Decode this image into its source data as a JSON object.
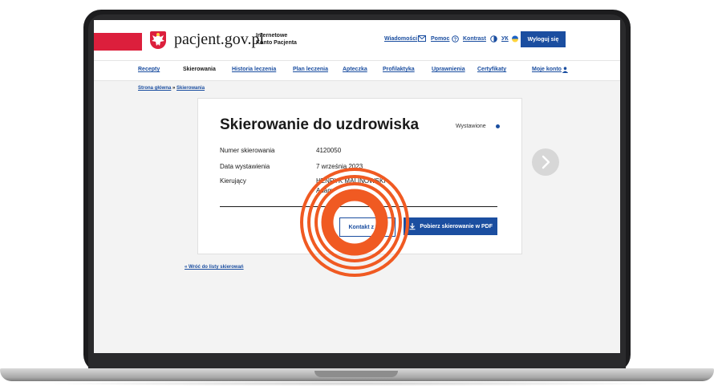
{
  "header": {
    "logo_text": "pacjent.gov.pl",
    "logo_sub_1": "Internetowe",
    "logo_sub_2": "Konto Pacjenta",
    "links": {
      "messages": "Wiadomości",
      "help": "Pomoc",
      "contrast": "Kontrast",
      "lang": "УК"
    },
    "logout": "Wyloguj się"
  },
  "nav": {
    "items": [
      "Recepty",
      "Skierowania",
      "Historia leczenia",
      "Plan leczenia",
      "Apteczka",
      "Profilaktyka",
      "Uprawnienia",
      "Certyfikaty"
    ],
    "active": "Skierowania",
    "account": "Moje konto"
  },
  "breadcrumb": {
    "home": "Strona główna",
    "separator": "»",
    "current": "Skierowania"
  },
  "card": {
    "title": "Skierowanie do uzdrowiska",
    "status": "Wystawione",
    "rows": [
      {
        "label": "Numer skierowania",
        "value": "4120050"
      },
      {
        "label": "Data wystawienia",
        "value": "7 września 2023"
      },
      {
        "label": "Kierujący",
        "value": "HENRYK MALINOWSKI"
      }
    ],
    "kierujacy_line2": "Adam",
    "btn_contact": "Kontakt z NFZ",
    "btn_download": "Pobierz skierowanie w PDF"
  },
  "back_link": "« Wróć do listy skierowań",
  "colors": {
    "brand_blue": "#1b4ea0",
    "brand_red": "#dc1f3c",
    "highlight_orange": "#f05a22"
  },
  "icons": [
    "eagle-emblem-icon",
    "envelope-icon",
    "help-circle-icon",
    "contrast-icon",
    "ukraine-flag-icon",
    "user-icon",
    "download-icon",
    "chevron-right-icon",
    "click-highlight-icon"
  ]
}
